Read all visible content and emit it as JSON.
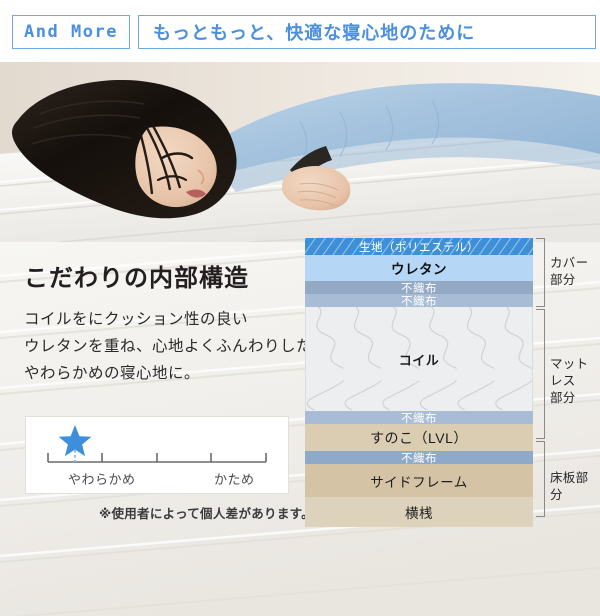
{
  "header": {
    "badge": "And More",
    "headline": "もっともっと、快適な寝心地のために",
    "accent_color": "#4a8fe0",
    "border_color": "#6fa8e8"
  },
  "photo": {
    "alt": "woman lying face down on white mattress",
    "shirt_color": "#a8c6e2",
    "hair_color": "#1b1510",
    "mattress_color": "#f2f1ee"
  },
  "lead": {
    "title": "こだわりの内部構造",
    "body_lines": [
      "コイルをにクッション性の良い",
      "ウレタンを重ね、心地よくふんわりした",
      "やわらかめの寝心地に。"
    ]
  },
  "firmness_scale": {
    "soft_label": "やわらかめ",
    "firm_label": "かため",
    "tick_count": 5,
    "marker_position_index": 1,
    "marker_icon": "star-icon",
    "marker_color": "#3d8fdb",
    "footnote": "※使用者によって個人差があります。"
  },
  "structure_diagram": {
    "layers": [
      {
        "name": "生地（ポリエステル）",
        "color": "#3d90d8",
        "hatched": true
      },
      {
        "name": "ウレタン",
        "color": "#b6d6f6",
        "hatched": false
      },
      {
        "name": "不織布",
        "color": "#94a9c4",
        "hatched": false
      },
      {
        "name": "不織布",
        "color": "#a8bcd6",
        "hatched": false
      },
      {
        "name": "コイル",
        "color": "#eceeef",
        "hatched": false
      },
      {
        "name": "不織布",
        "color": "#a8bcd6",
        "hatched": false
      },
      {
        "name": "すのこ（LVL）",
        "color": "#dbcdb2",
        "hatched": false
      },
      {
        "name": "不織布",
        "color": "#8fa9c9",
        "hatched": false
      },
      {
        "name": "サイドフレーム",
        "color": "#d4c3a4",
        "hatched": false
      },
      {
        "name": "横桟",
        "color": "#ddd2bb",
        "hatched": false
      }
    ],
    "brackets": [
      {
        "label_line1": "カバー",
        "label_line2": "部分"
      },
      {
        "label_line1": "マットレス",
        "label_line2": "部分"
      },
      {
        "label_line1": "床板部分",
        "label_line2": ""
      }
    ]
  }
}
